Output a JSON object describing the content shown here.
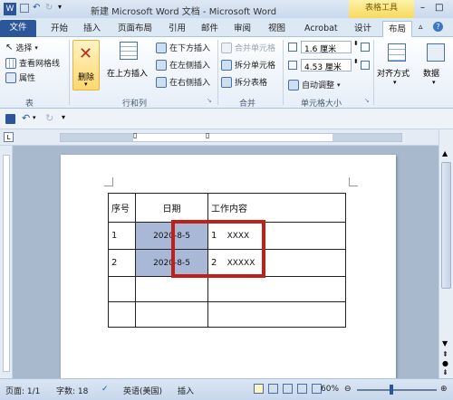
{
  "window": {
    "title": "新建 Microsoft Word 文档 - Microsoft Word",
    "context_tools": "表格工具"
  },
  "tabs": [
    "文件",
    "开始",
    "插入",
    "页面布局",
    "引用",
    "邮件",
    "审阅",
    "视图",
    "Acrobat",
    "设计",
    "布局"
  ],
  "ribbon": {
    "table_group": {
      "select": "选择",
      "gridlines": "查看网格线",
      "properties": "属性",
      "label": "表"
    },
    "delete": "删除",
    "insert_above": "在上方插入",
    "insert_below": "在下方插入",
    "insert_left": "在左侧插入",
    "insert_right": "在右侧插入",
    "rows_cols_label": "行和列",
    "merge_cells": "合并单元格",
    "split_cells": "拆分单元格",
    "split_table": "拆分表格",
    "merge_label": "合并",
    "height": "1.6 厘米",
    "width": "4.53 厘米",
    "autofit": "自动调整",
    "cell_size_label": "单元格大小",
    "align": "对齐方式",
    "data": "数据"
  },
  "document": {
    "headers": [
      "序号",
      "日期",
      "工作内容"
    ],
    "rows": [
      [
        "1",
        "2020-8-5",
        "1",
        "XXXX"
      ],
      [
        "2",
        "2020-8-5",
        "2",
        "XXXXX"
      ]
    ]
  },
  "status": {
    "page": "页面: 1/1",
    "words": "字数: 18",
    "lang": "英语(美国)",
    "mode": "插入",
    "zoom": "60%"
  },
  "colors": {
    "accent": "#2b579a",
    "highlight_box": "#c0201a",
    "selection": "#a9b8d6"
  }
}
